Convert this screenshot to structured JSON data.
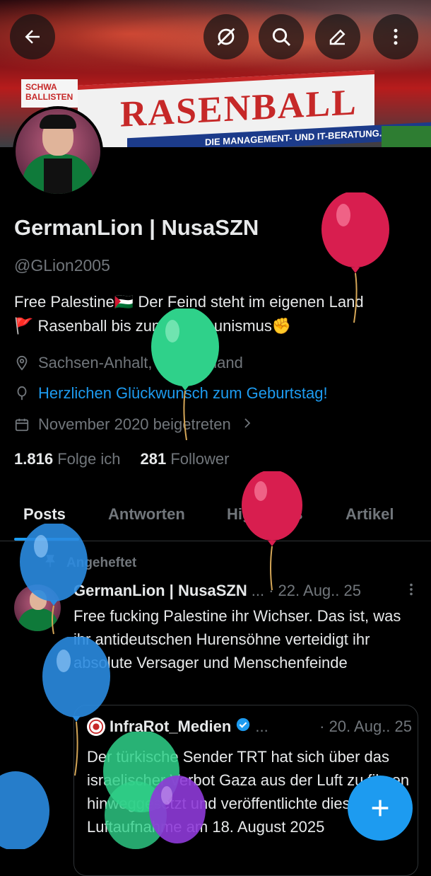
{
  "header": {
    "back_icon": "arrow-left-icon",
    "actions": [
      "mute-notifications-icon",
      "search-icon",
      "edit-icon",
      "more-icon"
    ]
  },
  "banner": {
    "flag_text": "RASENBALL",
    "board_text": "DIE MANAGEMENT- UND IT-BERATUNG.",
    "side_text": "SCHWA BALLISTEN"
  },
  "profile": {
    "name": "GermanLion | NusaSZN",
    "handle": "@GLion2005",
    "bio_line1": "Free Palestine🇵🇸 Der Feind steht im eigenen Land",
    "bio_line2": "🚩 Rasenball bis zum Kommunismus✊",
    "location": "Sachsen-Anhalt, Deutschland",
    "birthday": "Herzlichen Glückwunsch zum Geburtstag!",
    "joined": "November 2020 beigetreten",
    "following_count": "1.816",
    "following_label": "Folge ich",
    "followers_count": "281",
    "followers_label": "Follower"
  },
  "tabs": [
    {
      "label": "Posts",
      "active": true
    },
    {
      "label": "Antworten"
    },
    {
      "label": "Highlights"
    },
    {
      "label": "Artikel"
    }
  ],
  "pinned_label": "Angeheftet",
  "post": {
    "author": "GermanLion | NusaSZN",
    "ellipsis": "...",
    "date": "· 22. Aug.. 25",
    "text": "Free fucking Palestine ihr Wichser. Das ist, was ihr antideutschen Hurensöhne verteidigt ihr absolute Versager und Menschenfeinde",
    "quote": {
      "author": "InfraRot_Medien",
      "ellipsis": "...",
      "date": "· 20. Aug.. 25",
      "text": "Der türkische Sender TRT hat sich über das israelischer Verbot Gaza aus der Luft zu filmen hinweggesetzt und veröffentlichte diese Luftaufnahme am 18. August 2025"
    }
  },
  "fab_label": "+",
  "colors": {
    "accent": "#1d9bf0",
    "background": "#000000",
    "muted": "#71767b"
  }
}
